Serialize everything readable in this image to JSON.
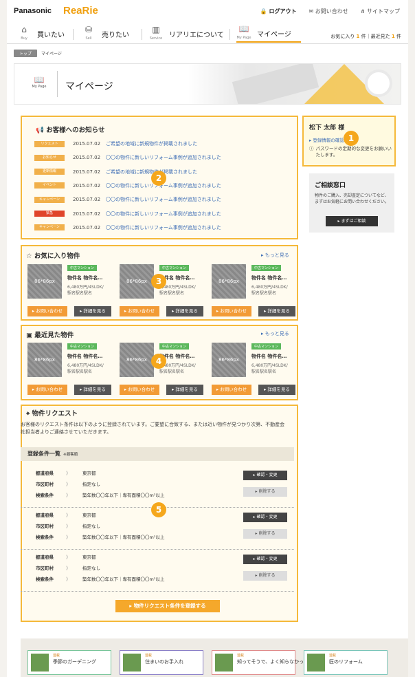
{
  "header": {
    "logo": "Panasonic",
    "brand": "ReaRie",
    "logout": "ログアウト",
    "contact": "お問い合わせ",
    "sitemap": "サイトマップ"
  },
  "nav": {
    "items": [
      {
        "icon_label": "Buy",
        "label": "買いたい"
      },
      {
        "icon_label": "Sell",
        "label": "売りたい"
      },
      {
        "icon_label": "Service",
        "label": "リアリエについて"
      },
      {
        "icon_label": "My Page",
        "label": "マイページ"
      }
    ],
    "favorites_label": "お気に入り",
    "favorites_count": "1",
    "recent_label": "最近見た",
    "recent_count": "1",
    "count_unit": "件"
  },
  "breadcrumb": {
    "home": "トップ",
    "current": "マイページ"
  },
  "banner": {
    "icon_label": "My Page",
    "title": "マイページ"
  },
  "notices": {
    "title": "お客様へのお知らせ",
    "items": [
      {
        "tag": "リクエスト",
        "date": "2015.07.02",
        "text": "ご希望の地域に新規物件が掲載されました",
        "color": "#f1b04a"
      },
      {
        "tag": "お知らせ",
        "date": "2015.07.02",
        "text": "〇〇の物件に新しいリフォーム事例が追加されました",
        "color": "#f1b04a"
      },
      {
        "tag": "更新情報",
        "date": "2015.07.02",
        "text": "ご希望の地域に新規物件が掲載されました",
        "color": "#f1b04a"
      },
      {
        "tag": "イベント",
        "date": "2015.07.02",
        "text": "〇〇の物件に新しいリフォーム事例が追加されました",
        "color": "#f1b04a"
      },
      {
        "tag": "キャンペーン",
        "date": "2015.07.02",
        "text": "〇〇の物件に新しいリフォーム事例が追加されました",
        "color": "#f1b04a"
      },
      {
        "tag": "緊急",
        "date": "2015.07.02",
        "text": "〇〇の物件に新しいリフォーム事例が追加されました",
        "color": "#e0452a"
      },
      {
        "tag": "キャンペーン",
        "date": "2015.07.02",
        "text": "〇〇の物件に新しいリフォーム事例が追加されました",
        "color": "#f1b04a"
      }
    ]
  },
  "favorites": {
    "title": "お気に入り物件",
    "more": "もっと見る",
    "cards": [
      {
        "thumb": "86*86px",
        "type": "中古マンション",
        "name": "物件名 物件名…",
        "price": "6,480万円/4SLDK/",
        "location": "駅名駅名駅名",
        "contact": "お問い合わせ",
        "detail": "詳細を見る"
      },
      {
        "thumb": "86*86px",
        "type": "中古マンション",
        "name": "物件名 物件名…",
        "price": "6,480万円/4SLDK/",
        "location": "駅名駅名駅名",
        "contact": "お問い合わせ",
        "detail": "詳細を見る"
      },
      {
        "thumb": "86*86px",
        "type": "中古マンション",
        "name": "物件名 物件名…",
        "price": "6,480万円/4SLDK/",
        "location": "駅名駅名駅名",
        "contact": "お問い合わせ",
        "detail": "詳細を見る"
      }
    ]
  },
  "recent": {
    "title": "最近見た物件",
    "more": "もっと見る",
    "cards": [
      {
        "thumb": "86*86px",
        "type": "中古マンション",
        "name": "物件名 物件名…",
        "price": "6,480万円/4SLDK/",
        "location": "駅名駅名駅名",
        "contact": "お問い合わせ",
        "detail": "詳細を見る"
      },
      {
        "thumb": "86*86px",
        "type": "中古マンション",
        "name": "物件名 物件名…",
        "price": "6,480万円/4SLDK/",
        "location": "駅名駅名駅名",
        "contact": "お問い合わせ",
        "detail": "詳細を見る"
      },
      {
        "thumb": "86*86px",
        "type": "中古マンション",
        "name": "物件名 物件名…",
        "price": "6,480万円/4SLDK/",
        "location": "駅名駅名駅名",
        "contact": "お問い合わせ",
        "detail": "詳細を見る"
      }
    ]
  },
  "request": {
    "title": "物件リクエスト",
    "description": "お客様のリクエスト条件は以下のように登録されています。ご要望に合致する、または近い物件が見つかり次第、不動産会社担当者よりご連絡させていただきます。",
    "list_title": "登録条件一覧",
    "list_note": "※顧客順",
    "labels": {
      "pref": "都道府県",
      "city": "市区町村",
      "search": "検索条件"
    },
    "conditions": [
      {
        "pref": "東京都",
        "city": "指定なし",
        "search": "築年数〇〇年以下｜専有面積〇〇m²以上",
        "confirm": "確認・変更",
        "delete": "削除する"
      },
      {
        "pref": "東京都",
        "city": "指定なし",
        "search": "築年数〇〇年以下｜専有面積〇〇m²以上",
        "confirm": "確認・変更",
        "delete": "削除する"
      },
      {
        "pref": "東京都",
        "city": "指定なし",
        "search": "築年数〇〇年以下｜専有面積〇〇m²以上",
        "confirm": "確認・変更",
        "delete": "削除する"
      }
    ],
    "register_button": "物件リクエスト条件を登録する"
  },
  "user": {
    "name": "松下 太郎 様",
    "link": "登録情報の確認・変更",
    "notice": "パスワードの定期的な変更をお願いいたします。"
  },
  "consult": {
    "title": "ご相談窓口",
    "text": "物件のご購入、売却査定についてなど、まずはお気軽にお問い合わせください。",
    "button": "まずはご相談"
  },
  "footer": {
    "cards": [
      {
        "tag": "連載",
        "text": "季節のガーデニング",
        "border": "#78c59a"
      },
      {
        "tag": "連載",
        "text": "住まいのお手入れ",
        "border": "#8a7fc8"
      },
      {
        "tag": "連載",
        "text": "知ってそうで、よく知らなかった中古住宅",
        "border": "#e08a8a"
      },
      {
        "tag": "連載",
        "text": "匠のリフォーム",
        "border": "#78c5b9"
      }
    ]
  },
  "annotations": [
    "1",
    "2",
    "3",
    "4",
    "5"
  ],
  "colors": {
    "accent": "#f5a71c",
    "highlight_border": "#f5b93a",
    "link": "#3d6db5"
  }
}
